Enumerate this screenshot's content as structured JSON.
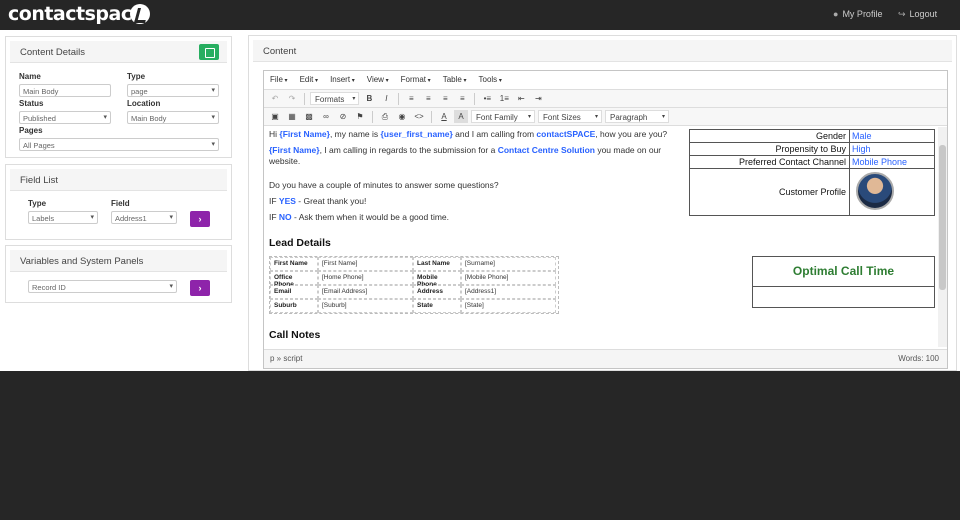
{
  "nav": {
    "logo": "contactspace",
    "my_profile": "My Profile",
    "logout": "Logout"
  },
  "content_details": {
    "title": "Content Details",
    "name_label": "Name",
    "name_value": "Main Body",
    "type_label": "Type",
    "type_value": "page",
    "status_label": "Status",
    "status_value": "Published",
    "location_label": "Location",
    "location_value": "Main Body",
    "pages_label": "Pages",
    "pages_value": "All Pages"
  },
  "field_list": {
    "title": "Field List",
    "type_label": "Type",
    "type_value": "Labels",
    "field_label": "Field",
    "field_value": "Address1"
  },
  "variables": {
    "title": "Variables and System Panels",
    "select_value": "Record ID"
  },
  "content": {
    "title": "Content",
    "menu": [
      "File",
      "Edit",
      "Insert",
      "View",
      "Format",
      "Table",
      "Tools"
    ],
    "toolbar": {
      "formats": "Formats",
      "font_family": "Font Family",
      "font_sizes": "Font Sizes",
      "paragraph": "Paragraph"
    },
    "script": {
      "line1_a": "Hi ",
      "line1_b": "{First Name}",
      "line1_c": ", my name is ",
      "line1_d": "{user_first_name}",
      "line1_e": " and I am calling from ",
      "line1_f": "contactSPACE",
      "line1_g": ", how you are you?",
      "line2_a": "{First Name}",
      "line2_b": ", I am calling in regards to the submission for a ",
      "line2_c": "Contact Centre Solution",
      "line2_d": " you made on our",
      "line2_e": "website.",
      "line3": "Do you have a couple of minutes to answer some questions?",
      "yes_a": "IF ",
      "yes_b": "YES",
      "yes_c": " - Great thank you!",
      "no_a": "IF ",
      "no_b": "NO",
      "no_c": " - Ask them when it would be a good time."
    },
    "profile": {
      "gender_k": "Gender",
      "gender_v": "Male",
      "propensity_k": "Propensity to Buy",
      "propensity_v": "High",
      "channel_k": "Preferred Contact Channel",
      "channel_v": "Mobile Phone",
      "profile_k": "Customer Profile"
    },
    "lead_details": {
      "heading": "Lead Details",
      "rows": [
        [
          "First Name",
          "[First Name]",
          "Last Name",
          "[Surname]"
        ],
        [
          "Office Phone",
          "[Home Phone]",
          "Mobile Phone",
          "[Mobile Phone]"
        ],
        [
          "Email",
          "[Email Address]",
          "Address",
          "[Address1]"
        ],
        [
          "Suburb",
          "[Suburb]",
          "State",
          "[State]"
        ]
      ]
    },
    "optimal_call_time": "Optimal Call Time",
    "call_notes": "Call Notes",
    "status_path": "p » script",
    "words": "Words: 100"
  }
}
